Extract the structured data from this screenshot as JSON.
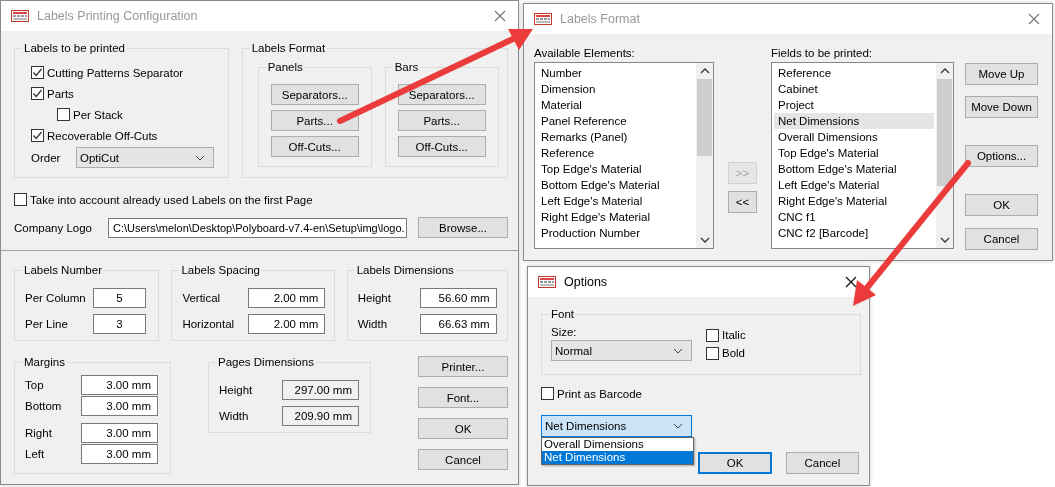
{
  "config_dialog": {
    "title": "Labels Printing Configuration",
    "labels_to_print": {
      "title": "Labels to be printed",
      "options": [
        {
          "label": "Cutting Patterns Separator",
          "checked": true
        },
        {
          "label": "Parts",
          "checked": true,
          "children": [
            {
              "label": "Per Stack",
              "checked": false
            }
          ]
        },
        {
          "label": "Recoverable Off-Cuts",
          "checked": true
        }
      ],
      "order": {
        "label": "Order",
        "value": "OptiCut"
      }
    },
    "labels_format": {
      "title": "Labels Format",
      "groups": [
        {
          "title": "Panels",
          "buttons": [
            "Separators...",
            "Parts...",
            "Off-Cuts..."
          ]
        },
        {
          "title": "Bars",
          "buttons": [
            "Separators...",
            "Parts...",
            "Off-Cuts..."
          ]
        }
      ]
    },
    "used_labels": {
      "label": "Take into account already used Labels on the first Page",
      "checked": false
    },
    "company_logo": {
      "label": "Company Logo",
      "value": "C:\\Users\\melon\\Desktop\\Polyboard-v7.4-en\\Setup\\img\\logo.",
      "button": "Browse..."
    },
    "labels_number": {
      "title": "Labels Number",
      "fields": [
        {
          "label": "Per Column",
          "value": "5"
        },
        {
          "label": "Per Line",
          "value": "3"
        }
      ]
    },
    "labels_spacing": {
      "title": "Labels Spacing",
      "fields": [
        {
          "label": "Vertical",
          "value": "2.00 mm"
        },
        {
          "label": "Horizontal",
          "value": "2.00 mm"
        }
      ]
    },
    "labels_dimensions": {
      "title": "Labels Dimensions",
      "fields": [
        {
          "label": "Height",
          "value": "56.60 mm"
        },
        {
          "label": "Width",
          "value": "66.63 mm"
        }
      ]
    },
    "margins": {
      "title": "Margins",
      "fields": [
        {
          "label": "Top",
          "value": "3.00 mm"
        },
        {
          "label": "Bottom",
          "value": "3.00 mm"
        },
        {
          "label": "Right",
          "value": "3.00 mm"
        },
        {
          "label": "Left",
          "value": "3.00 mm"
        }
      ]
    },
    "pages_dimensions": {
      "title": "Pages Dimensions",
      "fields": [
        {
          "label": "Height",
          "value": "297.00 mm",
          "readonly": true
        },
        {
          "label": "Width",
          "value": "209.90 mm",
          "readonly": true
        }
      ]
    },
    "buttons": [
      "Printer...",
      "Font...",
      "OK",
      "Cancel"
    ]
  },
  "format_dialog": {
    "title": "Labels Format",
    "available": {
      "label": "Available Elements:",
      "items": [
        {
          "label": "Number",
          "selected": false
        },
        {
          "label": "Dimension",
          "selected": false
        },
        {
          "label": "Material",
          "selected": false
        },
        {
          "label": "Panel Reference",
          "selected": false
        },
        {
          "label": "Remarks (Panel)",
          "selected": false
        },
        {
          "label": "Reference",
          "selected": false
        },
        {
          "label": "Top Edge's Material",
          "selected": false
        },
        {
          "label": "Bottom Edge's Material",
          "selected": false
        },
        {
          "label": "Left Edge's Material",
          "selected": false
        },
        {
          "label": "Right Edge's Material",
          "selected": false
        },
        {
          "label": "Production Number",
          "selected": false
        }
      ]
    },
    "transfer_buttons": [
      {
        "label": ">>",
        "disabled": true
      },
      {
        "label": "<<",
        "disabled": false
      }
    ],
    "fields": {
      "label": "Fields to be printed:",
      "items": [
        {
          "label": "Reference",
          "selected": false
        },
        {
          "label": "Cabinet",
          "selected": false
        },
        {
          "label": "Project",
          "selected": false
        },
        {
          "label": "Net Dimensions",
          "selected": true
        },
        {
          "label": "Overall Dimensions",
          "selected": false
        },
        {
          "label": "Top Edge's Material",
          "selected": false
        },
        {
          "label": "Bottom Edge's Material",
          "selected": false
        },
        {
          "label": "Left Edge's Material",
          "selected": false
        },
        {
          "label": "Right Edge's Material",
          "selected": false
        },
        {
          "label": "CNC f1",
          "selected": false
        },
        {
          "label": "CNC f2 [Barcode]",
          "selected": false
        }
      ]
    },
    "buttons": [
      "Move Up",
      "Move Down",
      "Options...",
      "OK",
      "Cancel"
    ]
  },
  "options_dialog": {
    "title": "Options",
    "font_group": {
      "title": "Font",
      "size_label": "Size:",
      "size_value": "Normal",
      "styles": [
        {
          "label": "Italic",
          "checked": false
        },
        {
          "label": "Bold",
          "checked": false
        }
      ]
    },
    "barcode": {
      "label": "Print as Barcode",
      "checked": false
    },
    "field_combo": {
      "value": "Net Dimensions",
      "options": [
        {
          "label": "Overall Dimensions",
          "selected": false
        },
        {
          "label": "Net Dimensions",
          "selected": true
        }
      ]
    },
    "buttons": [
      {
        "label": "OK",
        "default": true
      },
      {
        "label": "Cancel",
        "default": false
      }
    ]
  }
}
